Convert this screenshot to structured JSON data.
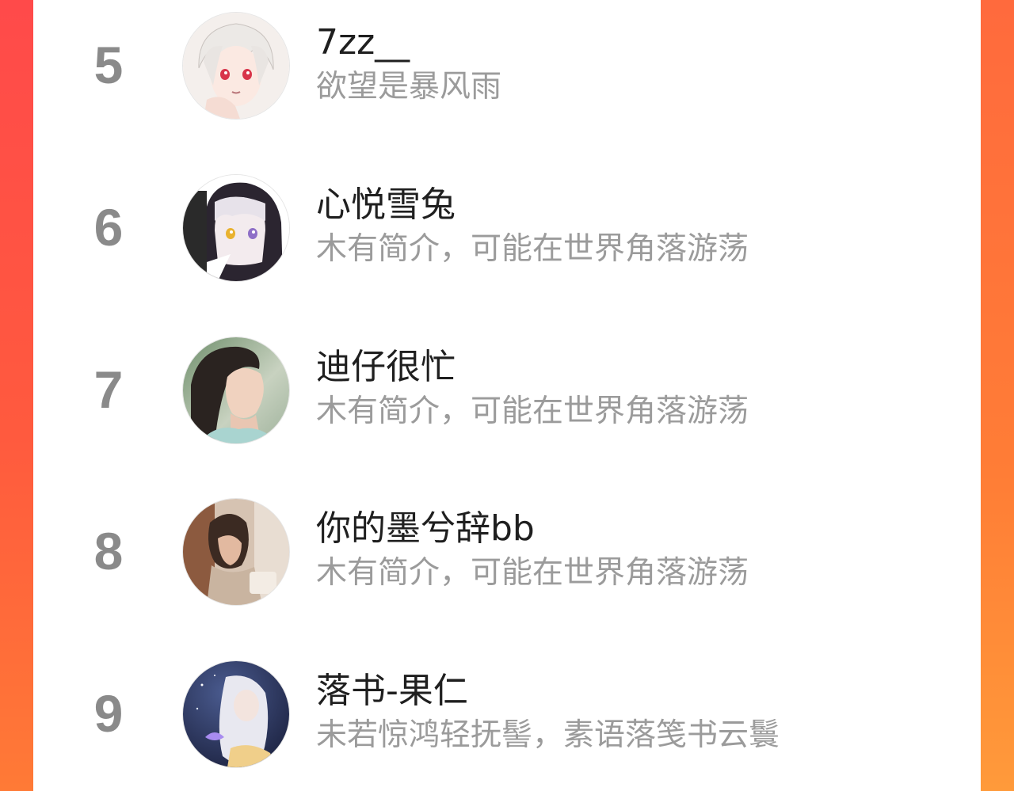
{
  "theme": {
    "accent_left": "#ff4a4a",
    "accent_right": "#ff7d36",
    "rank_color": "#8a8a8a",
    "name_color": "#1f1f1f",
    "bio_color": "#9b9b9b"
  },
  "ranking": {
    "items": [
      {
        "rank": "5",
        "name": "7zz__",
        "bio": "欲望是暴风雨",
        "avatar_icon": "anime-white-hair-avatar"
      },
      {
        "rank": "6",
        "name": "心悦雪兔",
        "bio": "木有简介，可能在世界角落游荡",
        "avatar_icon": "anime-dark-hair-avatar"
      },
      {
        "rank": "7",
        "name": "迪仔很忙",
        "bio": "木有简介，可能在世界角落游荡",
        "avatar_icon": "woman-photo-avatar"
      },
      {
        "rank": "8",
        "name": "你的墨兮辞bb",
        "bio": "木有简介，可能在世界角落游荡",
        "avatar_icon": "indoor-photo-avatar"
      },
      {
        "rank": "9",
        "name": "落书-果仁",
        "bio": "未若惊鸿轻抚髻，素语落笺书云鬟",
        "avatar_icon": "fantasy-art-avatar"
      }
    ]
  }
}
